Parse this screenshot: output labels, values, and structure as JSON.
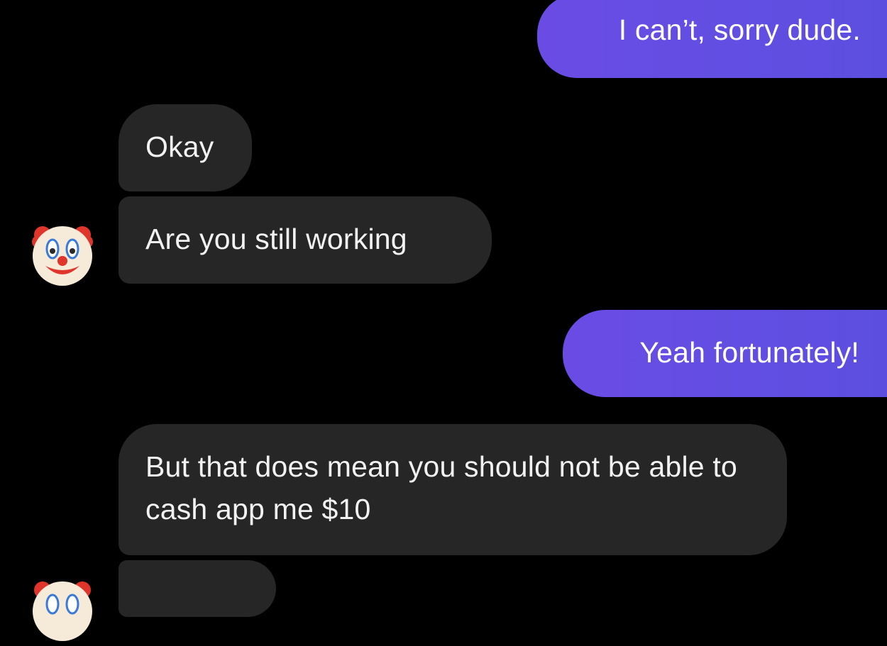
{
  "conversation": {
    "messages": [
      {
        "sender": "me",
        "text": "I can’t, sorry dude."
      },
      {
        "sender": "them",
        "text": "Okay"
      },
      {
        "sender": "them",
        "text": "Are you still working"
      },
      {
        "sender": "me",
        "text": "Yeah fortunately!"
      },
      {
        "sender": "them",
        "text": "But that does mean you should not be able to cash app me $10"
      },
      {
        "sender": "them",
        "text": ""
      }
    ],
    "contact_avatar_icon": "clown-face-icon"
  },
  "colors": {
    "background": "#000000",
    "outgoing_bubble": "#6a4ce4",
    "incoming_bubble": "#262626",
    "text": "#ffffff"
  }
}
